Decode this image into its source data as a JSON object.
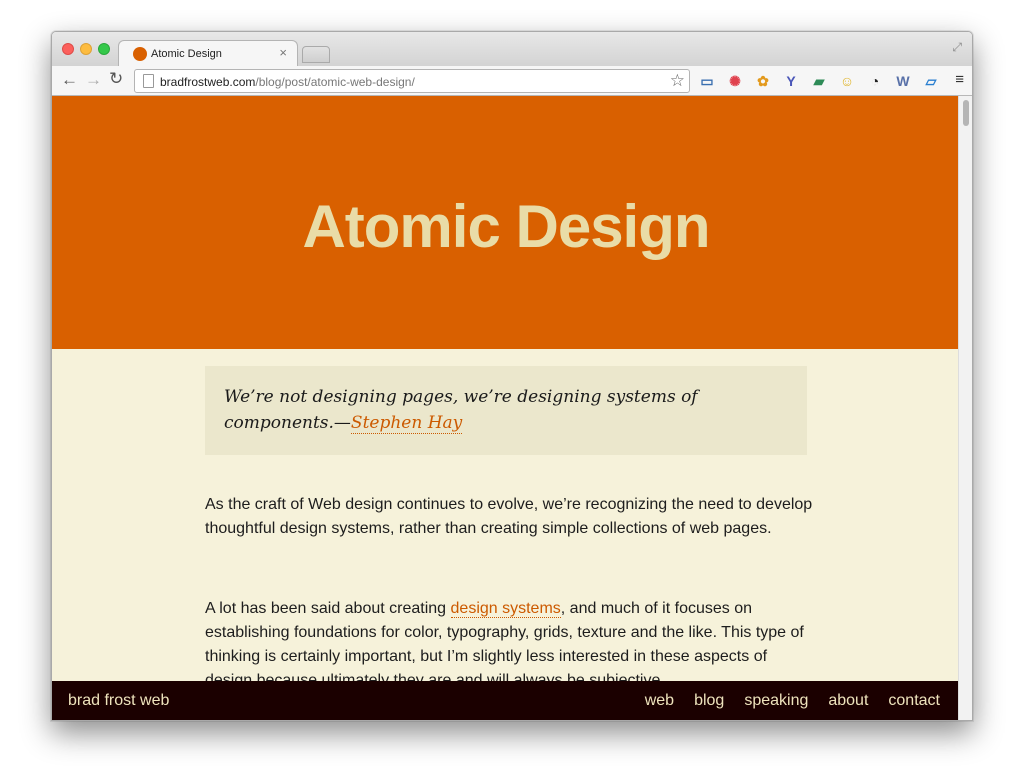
{
  "browser": {
    "tab_title": "Atomic Design",
    "tab_close": "×",
    "url_host": "bradfrostweb.com",
    "url_path": "/blog/post/atomic-web-design/",
    "back_glyph": "←",
    "forward_glyph": "→",
    "reload_glyph": "↻",
    "star_glyph": "☆",
    "menu_glyph": "≡",
    "fullscreen_glyph": "⤢",
    "extensions": [
      {
        "name": "screenshot-icon",
        "glyph": "▭",
        "color": "#3a6fb0"
      },
      {
        "name": "colorwheel-icon",
        "glyph": "✺",
        "color": "#e0424e"
      },
      {
        "name": "basket-icon",
        "glyph": "✿",
        "color": "#e39a1d"
      },
      {
        "name": "yslow-icon",
        "glyph": "Y",
        "color": "#4a56b8"
      },
      {
        "name": "chat-icon",
        "glyph": "▰",
        "color": "#2e8b57"
      },
      {
        "name": "face-icon",
        "glyph": "☺",
        "color": "#e0b52a"
      },
      {
        "name": "clock-icon",
        "glyph": "◔",
        "color": "#222222"
      },
      {
        "name": "wordpress-icon",
        "glyph": "W",
        "color": "#5870a8"
      },
      {
        "name": "pencil-icon",
        "glyph": "▱",
        "color": "#2a7fd0"
      }
    ]
  },
  "page": {
    "title": "Atomic Design",
    "quote_text": "We’re not designing pages, we’re designing systems of components.—",
    "quote_author": "Stephen Hay",
    "p1": "As the craft of Web design continues to evolve, we’re recognizing the need to develop thoughtful design systems, rather than creating simple collections of web pages.",
    "p2_before": "A lot has been said about creating ",
    "p2_link": "design systems",
    "p2_after": ", and much of it focuses on establishing foundations for color, typography, grids, texture and the like. This type of thinking is certainly important, but I’m slightly less interested in these aspects of design because ultimately they are and will always be subjective."
  },
  "footer": {
    "brand": "brad frost web",
    "nav": [
      "web",
      "blog",
      "speaking",
      "about",
      "contact"
    ]
  },
  "colors": {
    "hero": "#d96000",
    "hero_text": "#e9dca7",
    "page_bg": "#f6f2da",
    "link": "#cc5a00",
    "footer_bg": "#1b0000"
  }
}
